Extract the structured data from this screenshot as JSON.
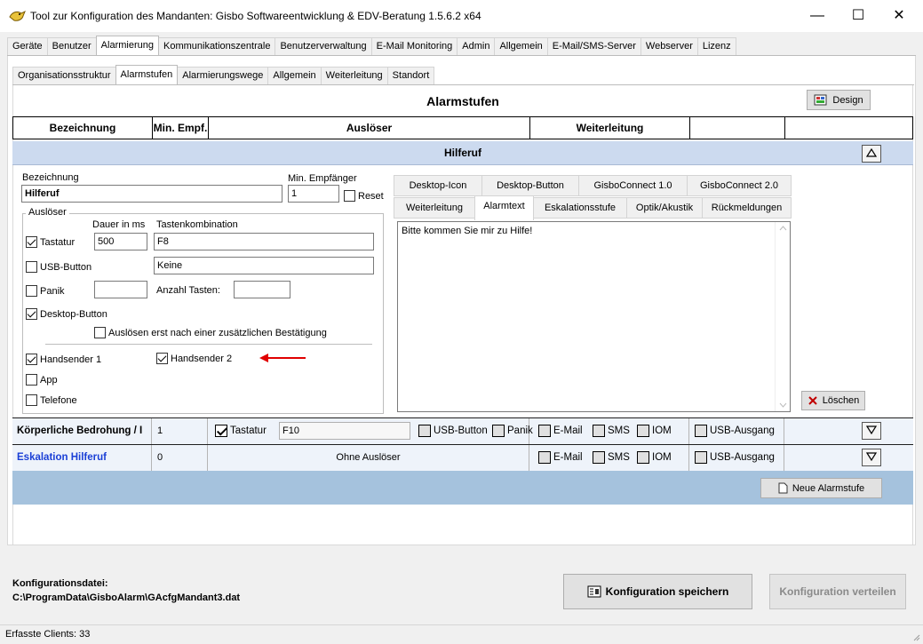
{
  "window": {
    "title": "Tool zur Konfiguration des Mandanten: Gisbo Softwareentwicklung & EDV-Beratung 1.5.6.2 x64",
    "minimize": "—",
    "maximize": "☐",
    "close": "✕"
  },
  "main_tabs": [
    {
      "label": "Geräte"
    },
    {
      "label": "Benutzer"
    },
    {
      "label": "Alarmierung"
    },
    {
      "label": "Kommunikationszentrale"
    },
    {
      "label": "Benutzerverwaltung"
    },
    {
      "label": "E-Mail Monitoring"
    },
    {
      "label": "Admin"
    },
    {
      "label": "Allgemein"
    },
    {
      "label": "E-Mail/SMS-Server"
    },
    {
      "label": "Webserver"
    },
    {
      "label": "Lizenz"
    }
  ],
  "sub_tabs": [
    {
      "label": "Organisationsstruktur"
    },
    {
      "label": "Alarmstufen"
    },
    {
      "label": "Alarmierungswege"
    },
    {
      "label": "Allgemein"
    },
    {
      "label": "Weiterleitung"
    },
    {
      "label": "Standort"
    }
  ],
  "page": {
    "heading": "Alarmstufen",
    "design_button": "Design"
  },
  "columns": [
    "Bezeichnung",
    "Min. Empf.",
    "Auslöser",
    "Weiterleitung"
  ],
  "expanded": {
    "band_title": "Hilferuf",
    "bezeichnung_label": "Bezeichnung",
    "bezeichnung_value": "Hilferuf",
    "min_empf_label": "Min. Empfänger",
    "min_empf_value": "1",
    "reset_label": "Reset",
    "ausloeser_legend": "Auslöser",
    "dauer_label": "Dauer in ms",
    "tastenkombination_label": "Tastenkombination",
    "tastatur_label": "Tastatur",
    "tastatur_dauer": "500",
    "tastatur_kombi": "F8",
    "usb_label": "USB-Button",
    "usb_value": "Keine",
    "panik_label": "Panik",
    "anzahl_tasten_label": "Anzahl Tasten:",
    "desktop_button_label": "Desktop-Button",
    "bestaetigung_label": "Auslösen erst nach einer zusätzlichen Bestätigung",
    "handsender1_label": "Handsender 1",
    "handsender2_label": "Handsender 2",
    "app_label": "App",
    "telefone_label": "Telefone",
    "right_tabs_row1": [
      "Desktop-Icon",
      "Desktop-Button",
      "GisboConnect 1.0",
      "GisboConnect 2.0"
    ],
    "right_tabs_row2": [
      "Weiterleitung",
      "Alarmtext",
      "Eskalationsstufe",
      "Optik/Akustik",
      "Rückmeldungen"
    ],
    "alarmtext": "Bitte kommen Sie mir zu Hilfe!",
    "loeschen_button": "Löschen",
    "arrow_color": "#e00000"
  },
  "rows": [
    {
      "name": "Körperliche Bedrohung / I",
      "min": "1",
      "tastatur_label": "Tastatur",
      "tastatur_value": "F10",
      "usb_label": "USB-Button",
      "panik_label": "Panik",
      "email_label": "E-Mail",
      "sms_label": "SMS",
      "iom_label": "IOM",
      "usb_ausgang_label": "USB-Ausgang"
    },
    {
      "name": "Eskalation Hilferuf",
      "min": "0",
      "ohne_label": "Ohne Auslöser",
      "email_label": "E-Mail",
      "sms_label": "SMS",
      "iom_label": "IOM",
      "usb_ausgang_label": "USB-Ausgang"
    }
  ],
  "neue_alarmstufe_button": "Neue Alarmstufe",
  "footer": {
    "config_label": "Konfigurationsdatei:",
    "config_path": "C:\\ProgramData\\GisboAlarm\\GAcfgMandant3.dat",
    "save_button": "Konfiguration speichern",
    "distribute_button": "Konfiguration verteilen",
    "status": "Erfasste Clients: 33"
  },
  "colors": {
    "band": "#ccdaef",
    "blue_band": "#a5c2dd",
    "link_blue": "#1a3fd6"
  }
}
